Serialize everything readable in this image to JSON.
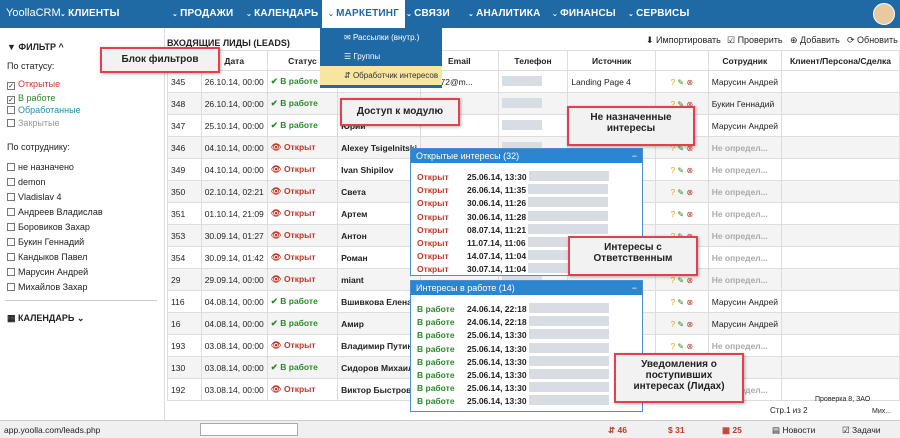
{
  "app": {
    "logo": "YoollaCRM"
  },
  "nav": [
    "КЛИЕНТЫ",
    "ПРОДАЖИ",
    "КАЛЕНДАРЬ",
    "МАРКЕТИНГ",
    "СВЯЗИ",
    "АНАЛИТИКА",
    "ФИНАНСЫ",
    "СЕРВИСЫ"
  ],
  "dropdown": [
    "Рассылки (внутр.)",
    "Группы",
    "Обработчик интересов"
  ],
  "sidebar": {
    "filter_title": "ФИЛЬТР",
    "by_status": "По статусу:",
    "statuses": [
      {
        "label": "Открытые",
        "checked": true,
        "color": "#c0392b"
      },
      {
        "label": "В работе",
        "checked": true,
        "color": "#2a8a2a"
      },
      {
        "label": "Обработанные",
        "checked": false,
        "color": "#2a8aa8"
      },
      {
        "label": "Закрытые",
        "checked": false,
        "color": "#999"
      }
    ],
    "by_employee": "По сотруднику:",
    "employees": [
      "не назначено",
      "demon",
      "Vladislav 4",
      "Андреев Владислав",
      "Боровиков Захар",
      "Букин Геннадий",
      "Кандыков Павел",
      "Марусин Андрей",
      "Михайлов Захар"
    ],
    "calendar": "КАЛЕНДАРЬ"
  },
  "main": {
    "title": "ВХОДЯЩИЕ ЛИДЫ (LEADS)",
    "toolbar": [
      "Импортировать",
      "Проверить",
      "Добавить",
      "Обновить"
    ],
    "columns": [
      "№",
      "Дата",
      "Статус",
      "",
      "Email",
      "Телефон",
      "Источник",
      "",
      "Сотрудник",
      "Клиент/Персона/Сделка"
    ],
    "rows": [
      {
        "id": "345",
        "date": "26.10.14, 00:00",
        "status": "В работе",
        "name": "",
        "email": "print72@m...",
        "source": "Landing Page 4",
        "emp": "Марусин Андрей"
      },
      {
        "id": "348",
        "date": "26.10.14, 00:00",
        "status": "В работе",
        "name": "",
        "email": "",
        "source": "",
        "emp": "Букин Геннадий"
      },
      {
        "id": "347",
        "date": "25.10.14, 00:00",
        "status": "В работе",
        "name": "Юрий",
        "email": "",
        "source": "",
        "emp": "Марусин Андрей"
      },
      {
        "id": "346",
        "date": "04.10.14, 00:00",
        "status": "Открыт",
        "name": "Alexey Tsigelnitski",
        "email": "",
        "source": "",
        "emp": "Не определ..."
      },
      {
        "id": "349",
        "date": "04.10.14, 00:00",
        "status": "Открыт",
        "name": "Ivan Shipilov",
        "email": "",
        "source": "",
        "emp": "Не определ..."
      },
      {
        "id": "350",
        "date": "02.10.14, 02:21",
        "status": "Открыт",
        "name": "Света",
        "email": "",
        "source": "",
        "emp": "Не определ..."
      },
      {
        "id": "351",
        "date": "01.10.14, 21:09",
        "status": "Открыт",
        "name": "Артем",
        "email": "",
        "source": "",
        "emp": "Не определ..."
      },
      {
        "id": "353",
        "date": "30.09.14, 01:27",
        "status": "Открыт",
        "name": "Антон",
        "email": "",
        "source": "",
        "emp": "Не определ..."
      },
      {
        "id": "354",
        "date": "30.09.14, 01:42",
        "status": "Открыт",
        "name": "Роман",
        "email": "",
        "source": "",
        "emp": "Не определ..."
      },
      {
        "id": "29",
        "date": "29.09.14, 00:00",
        "status": "Открыт",
        "name": "miant",
        "email": "",
        "source": "",
        "emp": "Не определ..."
      },
      {
        "id": "116",
        "date": "04.08.14, 00:00",
        "status": "В работе",
        "name": "Вшивкова Елена",
        "email": "",
        "source": "",
        "emp": "Марусин Андрей"
      },
      {
        "id": "16",
        "date": "04.08.14, 00:00",
        "status": "В работе",
        "name": "Амир",
        "email": "",
        "source": "",
        "emp": "Марусин Андрей"
      },
      {
        "id": "193",
        "date": "03.08.14, 00:00",
        "status": "Открыт",
        "name": "Владимир Путин",
        "email": "",
        "source": "",
        "emp": "Не определ..."
      },
      {
        "id": "130",
        "date": "03.08.14, 00:00",
        "status": "В работе",
        "name": "Сидоров Михаил",
        "email": "",
        "source": "",
        "emp": ""
      },
      {
        "id": "192",
        "date": "03.08.14, 00:00",
        "status": "Открыт",
        "name": "Виктор Быстров",
        "email": "",
        "source": "",
        "emp": "Не определ..."
      }
    ]
  },
  "panels": {
    "open": {
      "title": "Открытые интересы (32)",
      "status": "Открыт",
      "dates": [
        "25.06.14, 13:30",
        "26.06.14, 11:35",
        "30.06.14, 11:26",
        "30.06.14, 11:28",
        "08.07.14, 11:21",
        "11.07.14, 11:06",
        "14.07.14, 11:04",
        "30.07.14, 11:04"
      ]
    },
    "work": {
      "title": "Интересы в работе (14)",
      "status": "В работе",
      "dates": [
        "24.06.14, 22:18",
        "24.06.14, 22:18",
        "25.06.14, 13:30",
        "25.06.14, 13:30",
        "25.06.14, 13:30",
        "25.06.14, 13:30",
        "25.06.14, 13:30",
        "25.06.14, 13:30"
      ]
    }
  },
  "callouts": [
    "Блок фильтров",
    "Доступ к модулю",
    "Не назначенные интересы",
    "Интересы с Ответственным",
    "Уведомления о поступивших интересах (Лидах)"
  ],
  "statusbar": {
    "url": "app.yoolla.com/leads.php",
    "notif": "46",
    "badge1": "31",
    "badge2": "25",
    "news": "Новости",
    "tasks": "Задачи",
    "pages": "Стр.1 из 2",
    "extra": "Проверка 8, ЗАО",
    "mih": "Мих..."
  }
}
